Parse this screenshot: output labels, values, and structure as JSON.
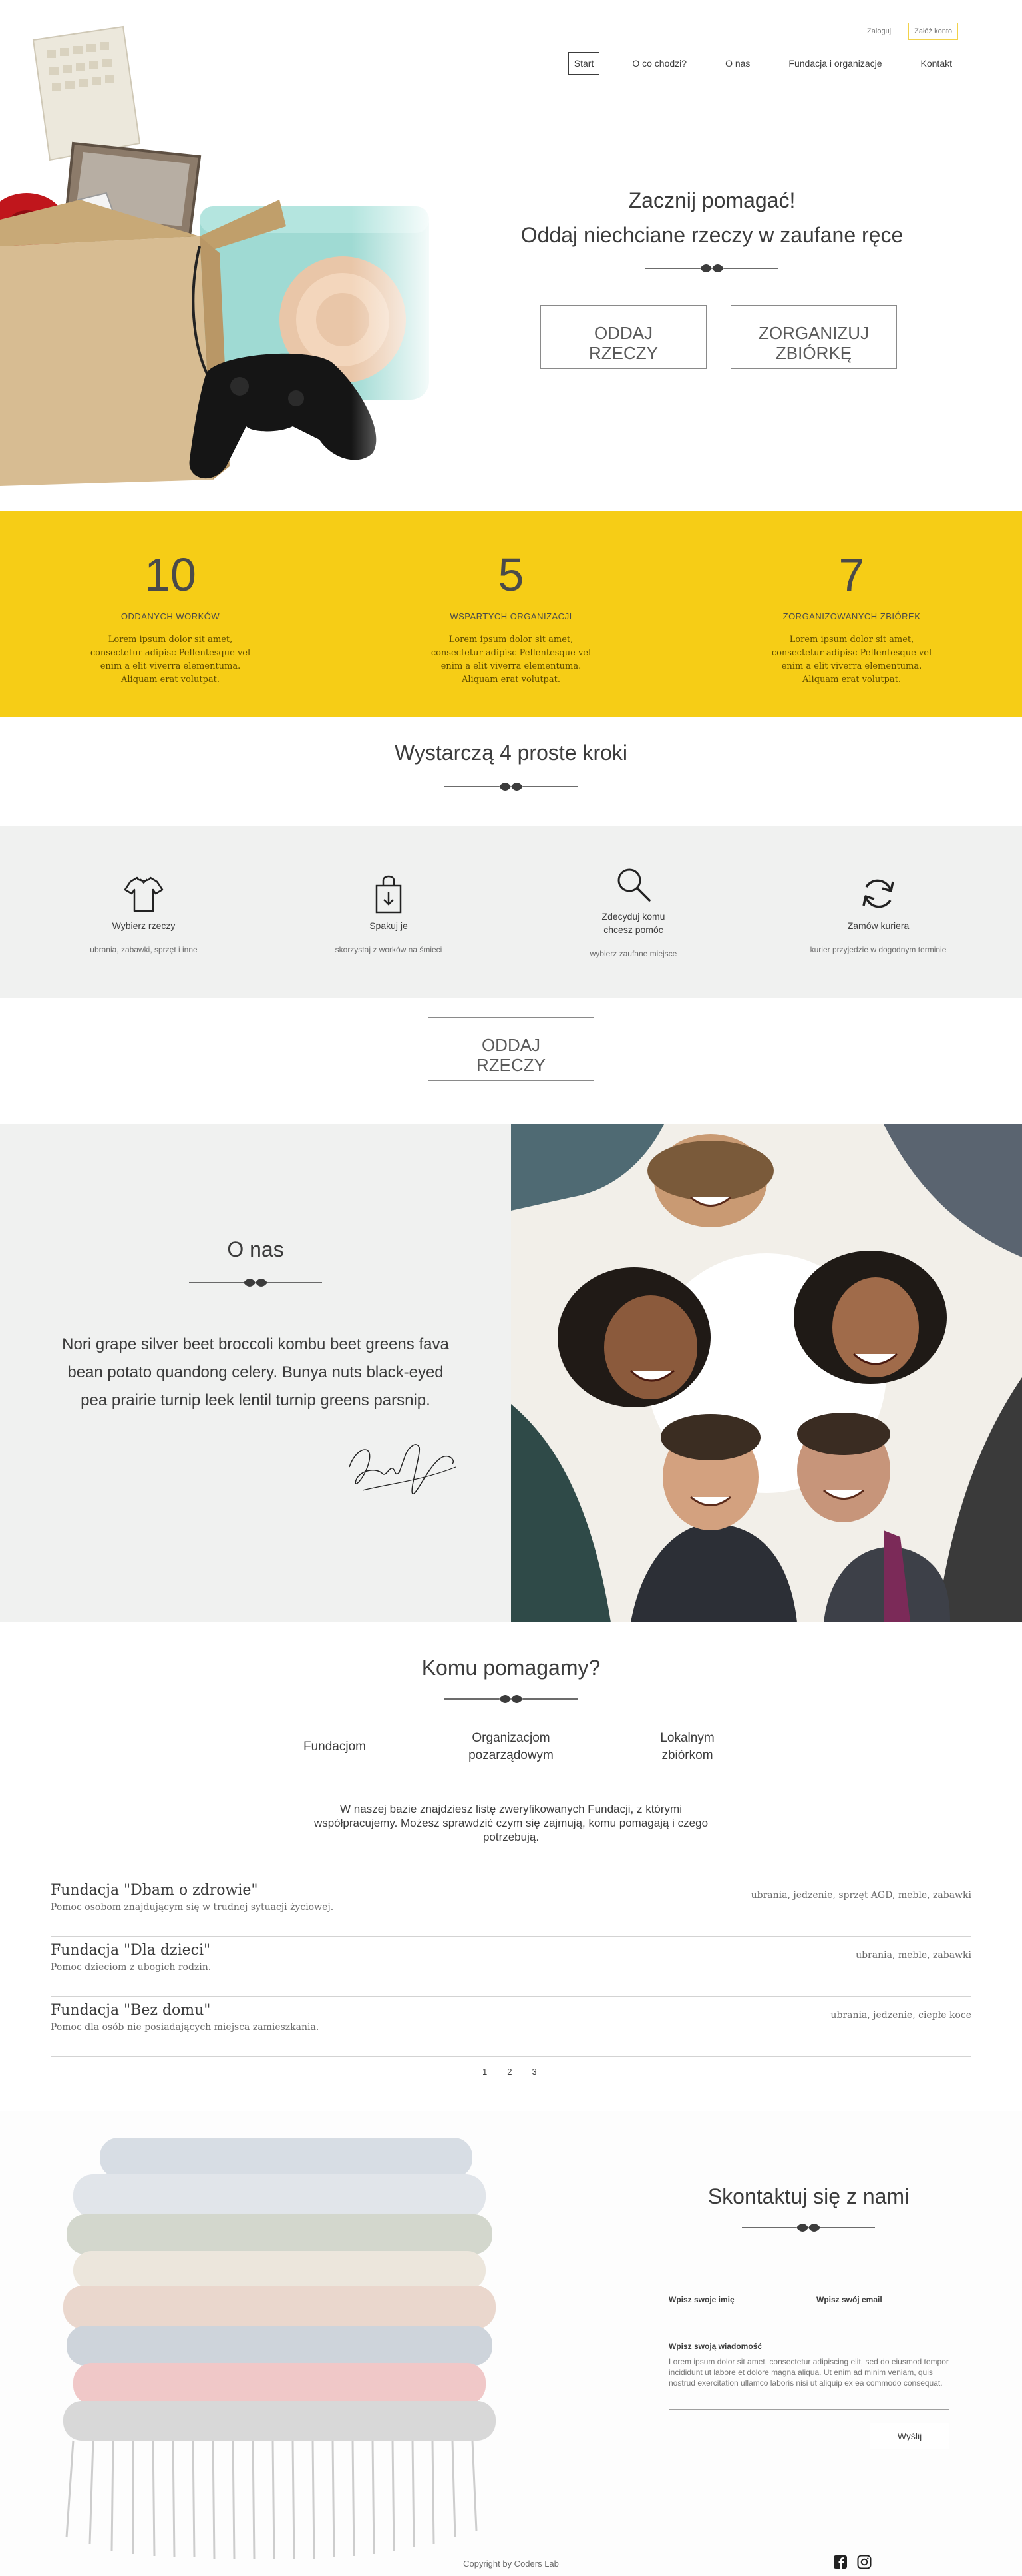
{
  "header": {
    "auth": {
      "login": "Zaloguj",
      "register": "Załóż konto"
    },
    "nav": [
      "Start",
      "O co chodzi?",
      "O nas",
      "Fundacja i organizacje",
      "Kontakt"
    ],
    "hero": {
      "line1": "Zacznij pomagać!",
      "line2": "Oddaj niechciane rzeczy w zaufane ręce",
      "buttons": [
        "ODDAJ\nRZECZY",
        "ZORGANIZUJ\nZBIÓRKĘ"
      ]
    }
  },
  "stats": [
    {
      "number": "10",
      "label": "ODDANYCH WORKÓW",
      "desc": "Lorem ipsum dolor sit amet, consectetur adipisc Pellentesque vel enim a elit viverra elementuma. Aliquam erat volutpat."
    },
    {
      "number": "5",
      "label": "WSPARTYCH ORGANIZACJI",
      "desc": "Lorem ipsum dolor sit amet, consectetur adipisc Pellentesque vel enim a elit viverra elementuma. Aliquam erat volutpat."
    },
    {
      "number": "7",
      "label": "ZORGANIZOWANYCH ZBIÓREK",
      "desc": "Lorem ipsum dolor sit amet, consectetur adipisc Pellentesque vel enim a elit viverra elementuma. Aliquam erat volutpat."
    }
  ],
  "steps": {
    "title": "Wystarczą 4 proste kroki",
    "items": [
      {
        "icon": "tshirt-icon",
        "title": "Wybierz rzeczy",
        "desc": "ubrania, zabawki, sprzęt i inne"
      },
      {
        "icon": "bag-icon",
        "title": "Spakuj je",
        "desc": "skorzystaj z worków na śmieci"
      },
      {
        "icon": "search-icon",
        "title": "Zdecyduj komu\nchcesz pomóc",
        "desc": "wybierz zaufane miejsce"
      },
      {
        "icon": "refresh-icon",
        "title": "Zamów kuriera",
        "desc": "kurier przyjedzie w dogodnym terminie"
      }
    ],
    "cta": "ODDAJ\nRZECZY"
  },
  "about": {
    "title": "O nas",
    "text": "Nori grape silver beet broccoli kombu beet greens fava bean potato quandong celery. Bunya nuts black-eyed pea prairie turnip leek lentil turnip greens parsnip."
  },
  "help": {
    "title": "Komu pomagamy?",
    "tabs": [
      "Fundacjom",
      "Organizacjom\npozarządowym",
      "Lokalnym\nzbiórkom"
    ],
    "intro": "W naszej bazie znajdziesz listę zweryfikowanych Fundacji, z którymi współpracujemy. Możesz sprawdzić czym się zajmują, komu pomagają i czego potrzebują.",
    "foundations": [
      {
        "name": "Fundacja \"Dbam o zdrowie\"",
        "desc": "Pomoc osobom znajdującym się w trudnej sytuacji życiowej.",
        "items": "ubrania, jedzenie, sprzęt AGD, meble, zabawki"
      },
      {
        "name": "Fundacja \"Dla dzieci\"",
        "desc": "Pomoc dzieciom z ubogich rodzin.",
        "items": "ubrania, meble, zabawki"
      },
      {
        "name": "Fundacja \"Bez domu\"",
        "desc": "Pomoc dla osób nie posiadających miejsca zamieszkania.",
        "items": "ubrania, jedzenie, ciepłe koce"
      }
    ],
    "pages": [
      "1",
      "2",
      "3"
    ]
  },
  "contact": {
    "title": "Skontaktuj się z nami",
    "name_label": "Wpisz swoje imię",
    "email_label": "Wpisz swój email",
    "message_label": "Wpisz swoją wiadomość",
    "message_placeholder": "Lorem ipsum dolor sit amet, consectetur adipiscing elit, sed do eiusmod tempor incididunt ut labore et dolore magna aliqua. Ut enim ad minim veniam, quis nostrud exercitation ullamco laboris nisi ut aliquip ex ea commodo consequat.",
    "submit": "Wyślij"
  },
  "footer": {
    "copyright": "Copyright by Coders Lab",
    "social": [
      "facebook-icon",
      "instagram-icon"
    ]
  },
  "colors": {
    "accent": "#f6cd16",
    "text": "#3c3c3c",
    "panel": "#f0f1f0"
  }
}
